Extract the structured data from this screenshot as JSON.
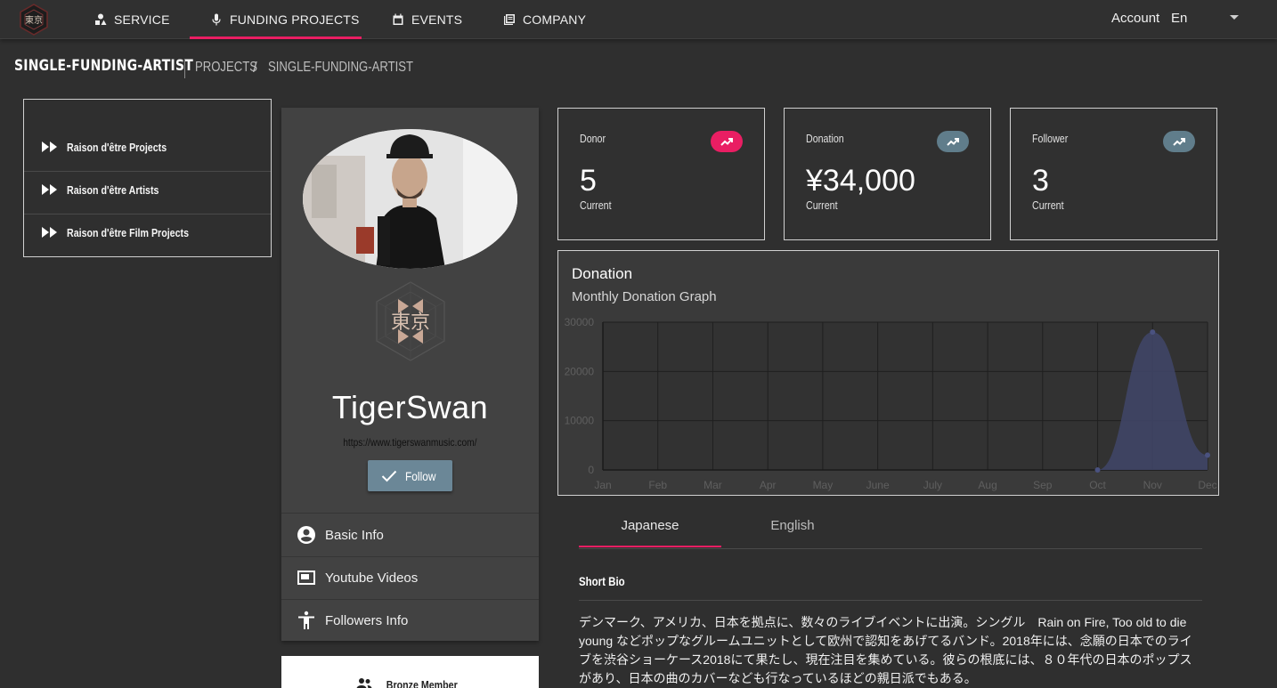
{
  "nav": {
    "items": [
      {
        "label": "SERVICE",
        "icon": "service-icon"
      },
      {
        "label": "FUNDING PROJECTS",
        "icon": "mic-icon",
        "active": true
      },
      {
        "label": "EVENTS",
        "icon": "calendar-icon"
      },
      {
        "label": "COMPANY",
        "icon": "library-icon"
      }
    ],
    "account": "Account",
    "language": "En",
    "accent_color": "#e91e63"
  },
  "page": {
    "title": "SINGLE-FUNDING-ARTIST",
    "breadcrumb": {
      "projects": "PROJECTS",
      "separator": "/",
      "current": "SINGLE-FUNDING-ARTIST"
    }
  },
  "left_menu": {
    "items": [
      {
        "label": "Raison d'être Projects"
      },
      {
        "label": "Raison d'être Artists"
      },
      {
        "label": "Raison d'être Film Projects"
      }
    ]
  },
  "profile": {
    "name": "TigerSwan",
    "url": "https://www.tigerswanmusic.com/",
    "follow_label": "Follow",
    "menu": [
      {
        "label": "Basic Info",
        "icon": "account-circle-icon"
      },
      {
        "label": "Youtube Videos",
        "icon": "video-icon"
      },
      {
        "label": "Followers Info",
        "icon": "accessibility-icon"
      }
    ],
    "member_label": "Bronze Member"
  },
  "stats": [
    {
      "label": "Donor",
      "value": "5",
      "sub": "Current",
      "badge_color": "#e91e63"
    },
    {
      "label": "Donation",
      "value": "¥34,000",
      "sub": "Current",
      "badge_color": "#607d8b"
    },
    {
      "label": "Follower",
      "value": "3",
      "sub": "Current",
      "badge_color": "#607d8b"
    }
  ],
  "chart_data": {
    "type": "area",
    "title": "Donation",
    "subtitle": "Monthly Donation Graph",
    "categories": [
      "Jan",
      "Feb",
      "Mar",
      "Apr",
      "May",
      "June",
      "July",
      "Aug",
      "Sep",
      "Oct",
      "Nov",
      "Dec"
    ],
    "values": [
      0,
      0,
      0,
      0,
      0,
      0,
      0,
      0,
      0,
      0,
      28000,
      3000
    ],
    "ylim": [
      0,
      30000
    ],
    "yticks": [
      0,
      10000,
      20000,
      30000
    ],
    "grid": true,
    "series_color": "#3f4566"
  },
  "tabs": [
    {
      "label": "Japanese",
      "active": true
    },
    {
      "label": "English",
      "active": false
    }
  ],
  "bio": {
    "title": "Short Bio",
    "text": "デンマーク、アメリカ、日本を拠点に、数々のライブイベントに出演。シングル　Rain on Fire, Too old to die young などポップなグルームユニットとして欧州で認知をあげてるバンド。2018年には、念願の日本でのライブを渋谷ショーケース2018にて果たし、現在注目を集めている。彼らの根底には、８０年代の日本のポップスがあり、日本の曲のカバーなども行なっているほどの親日派でもある。"
  }
}
